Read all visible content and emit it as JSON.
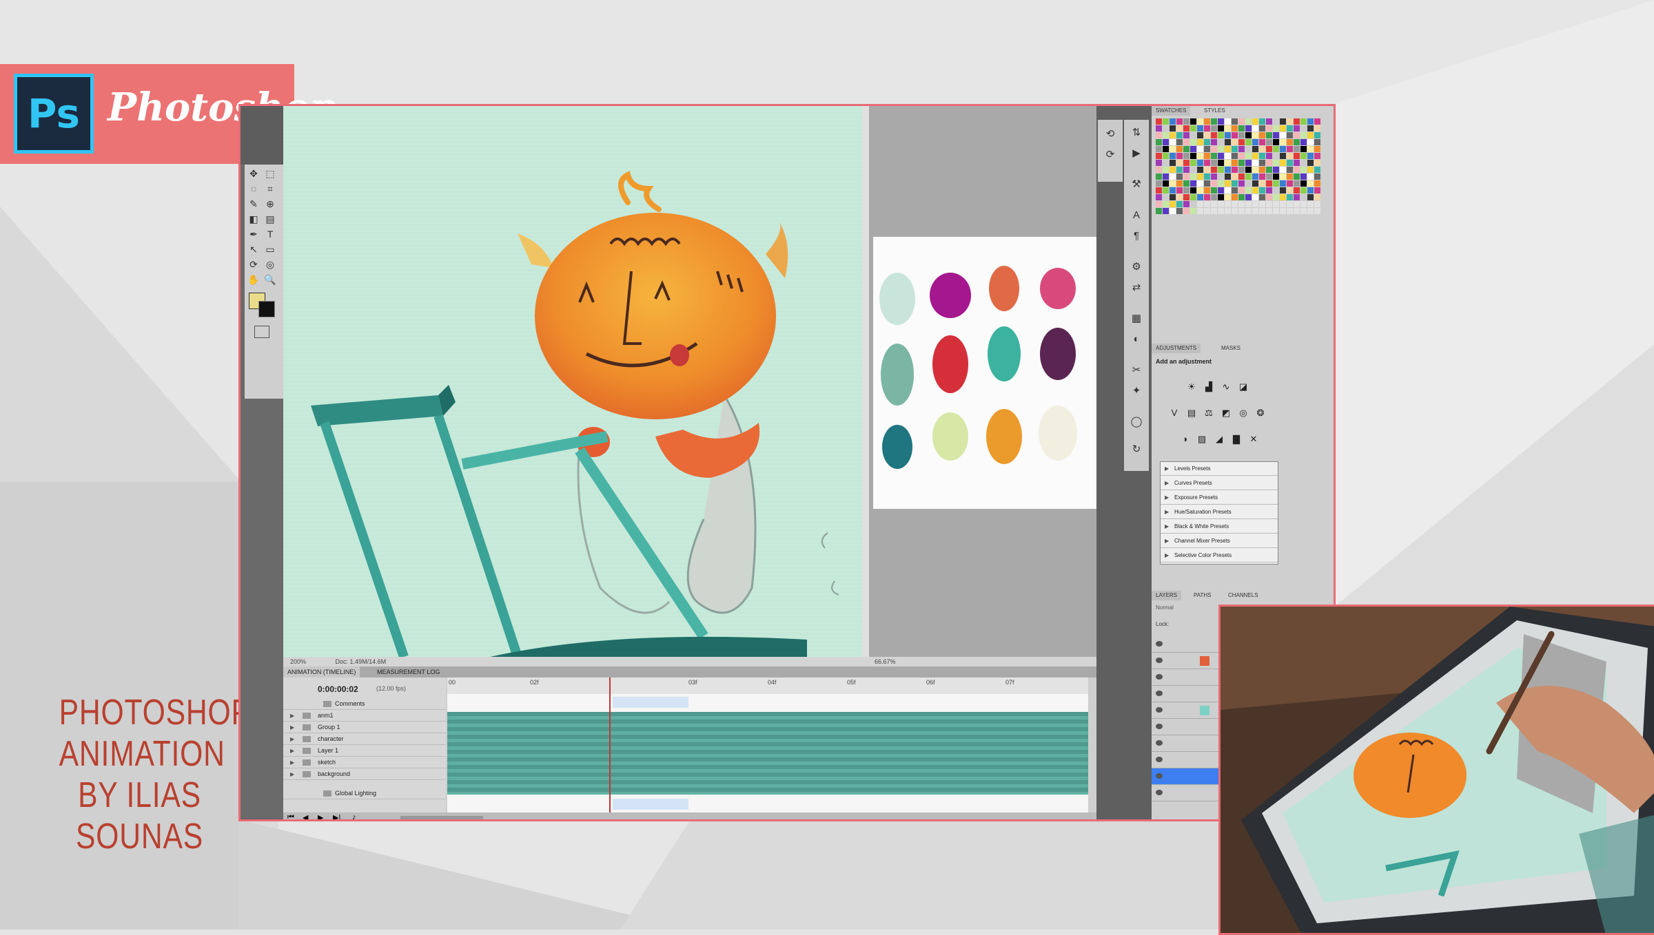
{
  "badge": {
    "logo_text": "Ps",
    "app_name": "Photoshop"
  },
  "caption": {
    "line1": "Photoshop",
    "line2": "Animation",
    "line3": "By Ilias Sounas"
  },
  "canvas": {
    "zoom_status": "200%",
    "doc_info": "Doc: 1.49M/14.6M"
  },
  "doc2": {
    "zoom_status": "66.67%"
  },
  "timeline": {
    "tab_animation": "ANIMATION (TIMELINE)",
    "tab_measurement": "MEASUREMENT LOG",
    "current_time": "0:00:00:02",
    "fps": "(12.00 fps)",
    "layers": [
      "Comments",
      "anm1",
      "Group 1",
      "character",
      "Layer 1",
      "sketch",
      "background",
      "Global Lighting"
    ],
    "ticks": [
      "00",
      "02f",
      "",
      "03f",
      "04f",
      "05f",
      "06f",
      "07f"
    ]
  },
  "panels": {
    "tab_swatches": "SWATCHES",
    "tab_styles": "STYLES",
    "tab_adjustments": "ADJUSTMENTS",
    "tab_masks": "MASKS",
    "adj_title": "Add an adjustment",
    "presets": [
      "Levels Presets",
      "Curves Presets",
      "Exposure Presets",
      "Hue/Saturation Presets",
      "Black & White Presets",
      "Channel Mixer Presets",
      "Selective Color Presets"
    ],
    "tab_layers": "LAYERS",
    "tab_paths": "PATHS",
    "tab_channels": "CHANNELS",
    "blend_mode": "Normal",
    "lock_label": "Lock:"
  },
  "colors": {
    "accent": "#e96b74",
    "ps_blue": "#31c5f4",
    "canvas_bg": "#c5e8d9",
    "teal": "#3fa79a",
    "orange": "#ef8f2a"
  }
}
